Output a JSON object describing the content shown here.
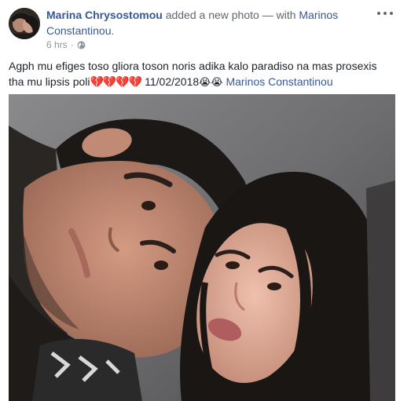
{
  "post": {
    "author_name": "Marina Chrysostomou",
    "action_text": "added a new photo",
    "with_text": "— with",
    "tagged_name": "Marinos Constantinou",
    "period": ".",
    "timestamp": "6 hrs",
    "separator": "·",
    "privacy_icon": "globe-icon",
    "more_icon": "more-options-icon",
    "body_text": "Agph mu efiges toso gliora toson noris adika kalo paradiso na mas prosexis tha mu lipsis poli",
    "body_hearts": "💔💔💔💔",
    "body_date": "11/02/2018",
    "body_emojis": "😭😭",
    "body_tag": "Marinos Constantinou"
  },
  "colors": {
    "link": "#365899",
    "meta": "#90949c",
    "text": "#1d2129"
  }
}
